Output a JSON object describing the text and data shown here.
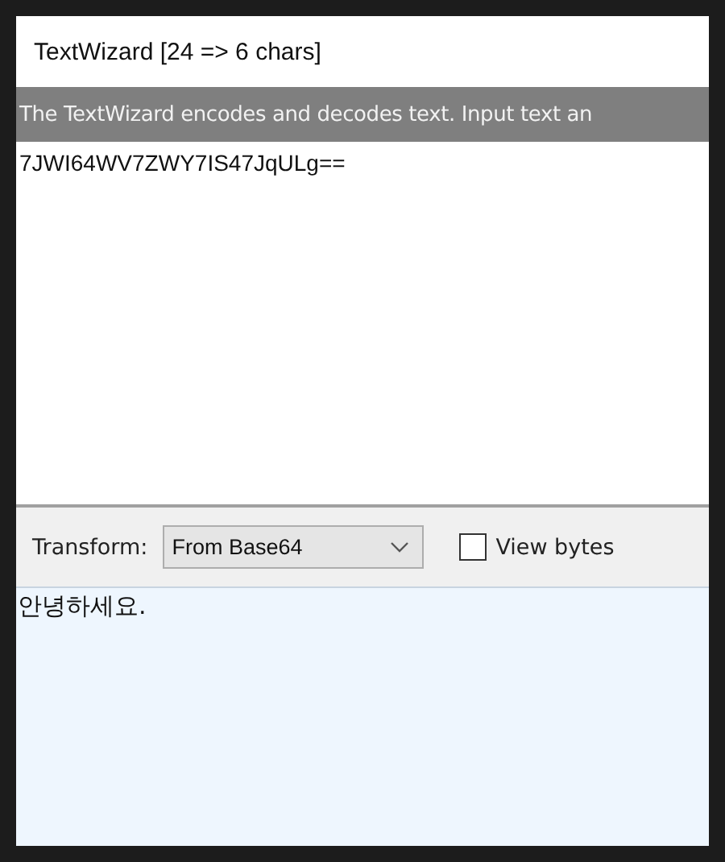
{
  "window": {
    "title": "TextWizard [24 => 6 chars]"
  },
  "banner": {
    "text": "The TextWizard encodes and decodes text. Input text an"
  },
  "input": {
    "value": "7JWI64WV7ZWY7IS47JqULg=="
  },
  "toolbar": {
    "transform_label": "Transform:",
    "transform_value": "From Base64",
    "view_bytes": {
      "label": "View bytes",
      "checked": false
    }
  },
  "output": {
    "value": "안녕하세요."
  }
}
